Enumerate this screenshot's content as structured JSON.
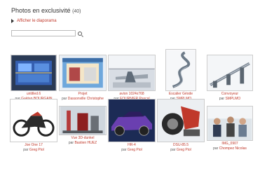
{
  "header": {
    "title": "Photos en exclusivité",
    "count": "(40)"
  },
  "slideshow": {
    "label": "Afficher le diaporama"
  },
  "search": {
    "placeholder": ""
  },
  "photos": [
    {
      "title": "untitled.6",
      "by": "par",
      "author": "Gaëtan BOURGAIN"
    },
    {
      "title": "Projet",
      "by": "par",
      "author": "Dassonville Christophe"
    },
    {
      "title": "avion 1024x768",
      "by": "par",
      "author": "FOURNIER Pascal"
    },
    {
      "title": "Escalier Géode",
      "by": "par",
      "author": "SMPLMO"
    },
    {
      "title": "Convoyeur",
      "by": "par",
      "author": "SMPLMO"
    },
    {
      "title": "Joe One 17",
      "by": "par",
      "author": "Greg Piol"
    },
    {
      "title": "Vue 3D-dunkel",
      "by": "par",
      "author": "Bastien HUEZ"
    },
    {
      "title": "HR-4",
      "by": "par",
      "author": "Greg Piol"
    },
    {
      "title": "DSU-85.5",
      "by": "par",
      "author": "Greg Piol"
    },
    {
      "title": "IMG_0907",
      "by": "par",
      "author": "Chompez Nicolas"
    }
  ]
}
